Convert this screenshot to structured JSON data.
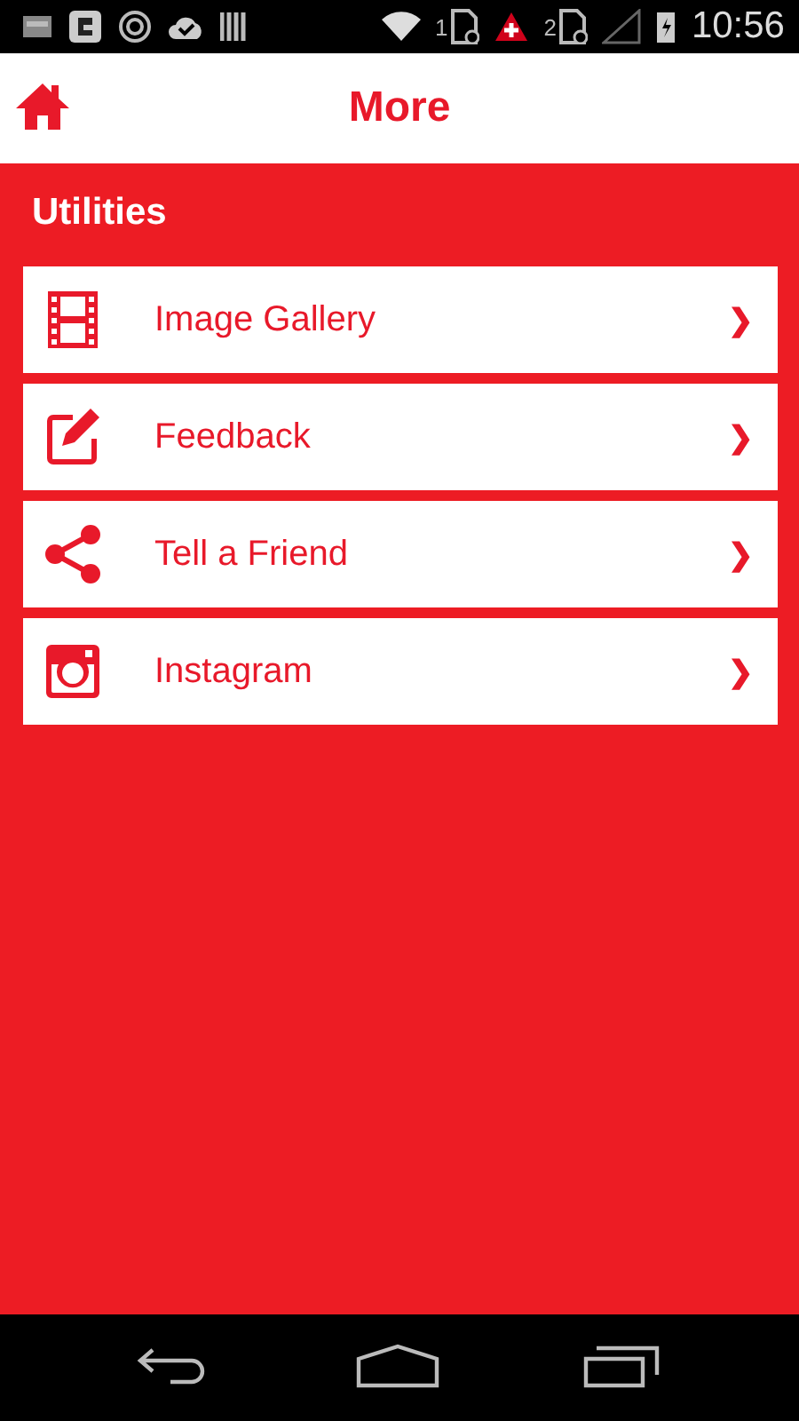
{
  "status_bar": {
    "sim_1": "1",
    "sim_2": "2",
    "time": "10:56"
  },
  "header": {
    "title": "More"
  },
  "section": {
    "title": "Utilities"
  },
  "items": [
    {
      "kind": "film",
      "label": "Image Gallery",
      "chevron": "❯"
    },
    {
      "kind": "edit",
      "label": "Feedback",
      "chevron": "❯"
    },
    {
      "kind": "share",
      "label": "Tell a Friend",
      "chevron": "❯"
    },
    {
      "kind": "camera",
      "label": "Instagram",
      "chevron": "❯"
    }
  ]
}
